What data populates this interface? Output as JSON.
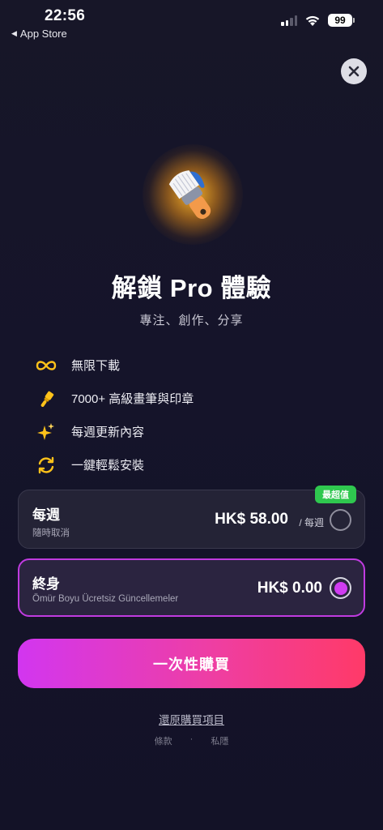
{
  "status_bar": {
    "time": "22:56",
    "back_app": "App Store",
    "battery": "99"
  },
  "hero": {
    "title": "解鎖 Pro 體驗",
    "subtitle": "專注、創作、分享"
  },
  "features": [
    {
      "icon": "infinity-icon",
      "label": "無限下載"
    },
    {
      "icon": "brush-icon",
      "label": "7000+ 高級畫筆與印章"
    },
    {
      "icon": "sparkles-icon",
      "label": "每週更新內容"
    },
    {
      "icon": "sync-icon",
      "label": "一鍵輕鬆安裝"
    }
  ],
  "plans": {
    "weekly": {
      "name": "每週",
      "subtitle": "隨時取消",
      "price": "HK$ 58.00",
      "period": "/ 每週",
      "badge": "最超值",
      "selected": false
    },
    "lifetime": {
      "name": "終身",
      "subtitle": "Ömür Boyu Ücretsiz Güncellemeler",
      "price": "HK$ 0.00",
      "selected": true
    }
  },
  "cta_label": "一次性購買",
  "restore_label": "還原購買項目",
  "legal": {
    "terms": "條款",
    "separator": "·",
    "privacy": "私隱"
  },
  "colors": {
    "accent": "#cf3cf0",
    "badge": "#2fc84f",
    "gradient_start": "#d236f0",
    "gradient_end": "#ff3a68",
    "feature_icon": "#ffc21a"
  }
}
